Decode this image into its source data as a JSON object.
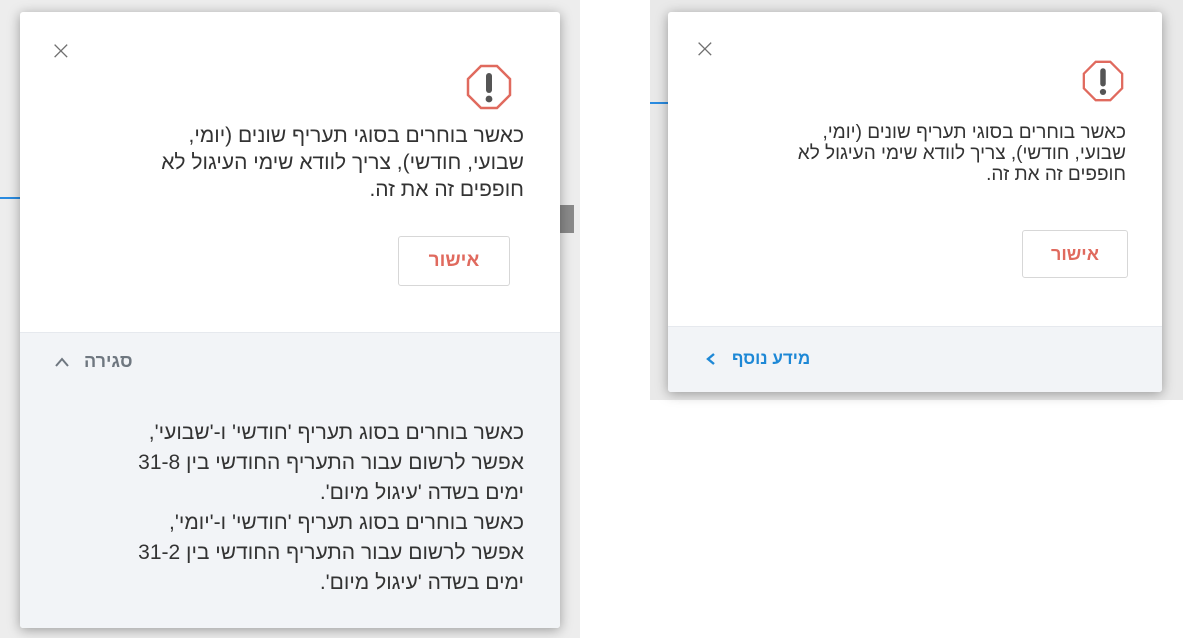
{
  "dialogs": [
    {
      "close_glyph": "×",
      "icon": "warning-icon",
      "message_lines": [
        "כאשר בוחרים בסוגי תעריף שונים (יומי,",
        "שבועי, חודשי), צריך לוודא שימי העיגול לא",
        "חופפים זה את זה."
      ],
      "confirm_label": "אישור",
      "toggle_label": "סגירה",
      "toggle_icon": "chevron-up-icon",
      "expanded": true,
      "details_lines": [
        "כאשר בוחרים בסוג תעריף 'חודשי' ו-'שבועי',",
        "אפשר לרשום עבור התעריף החודשי בין 31-8",
        "ימים בשדה 'עיגול מיום'.",
        "כאשר בוחרים בסוג תעריף 'חודשי' ו-'יומי',",
        "אפשר לרשום עבור התעריף החודשי בין 31-2",
        "ימים בשדה 'עיגול מיום'."
      ]
    },
    {
      "close_glyph": "×",
      "icon": "warning-icon",
      "message_lines": [
        "כאשר בוחרים בסוגי תעריף שונים (יומי,",
        "שבועי, חודשי), צריך לוודא שימי העיגול לא",
        "חופפים זה את זה."
      ],
      "confirm_label": "אישור",
      "toggle_label": "מידע נוסף",
      "toggle_icon": "chevron-left-icon",
      "expanded": false
    }
  ],
  "colors": {
    "accent_red": "#e06a5e",
    "link_blue": "#1e88d6",
    "collapse_gray": "#6f7780",
    "text": "#333333"
  }
}
